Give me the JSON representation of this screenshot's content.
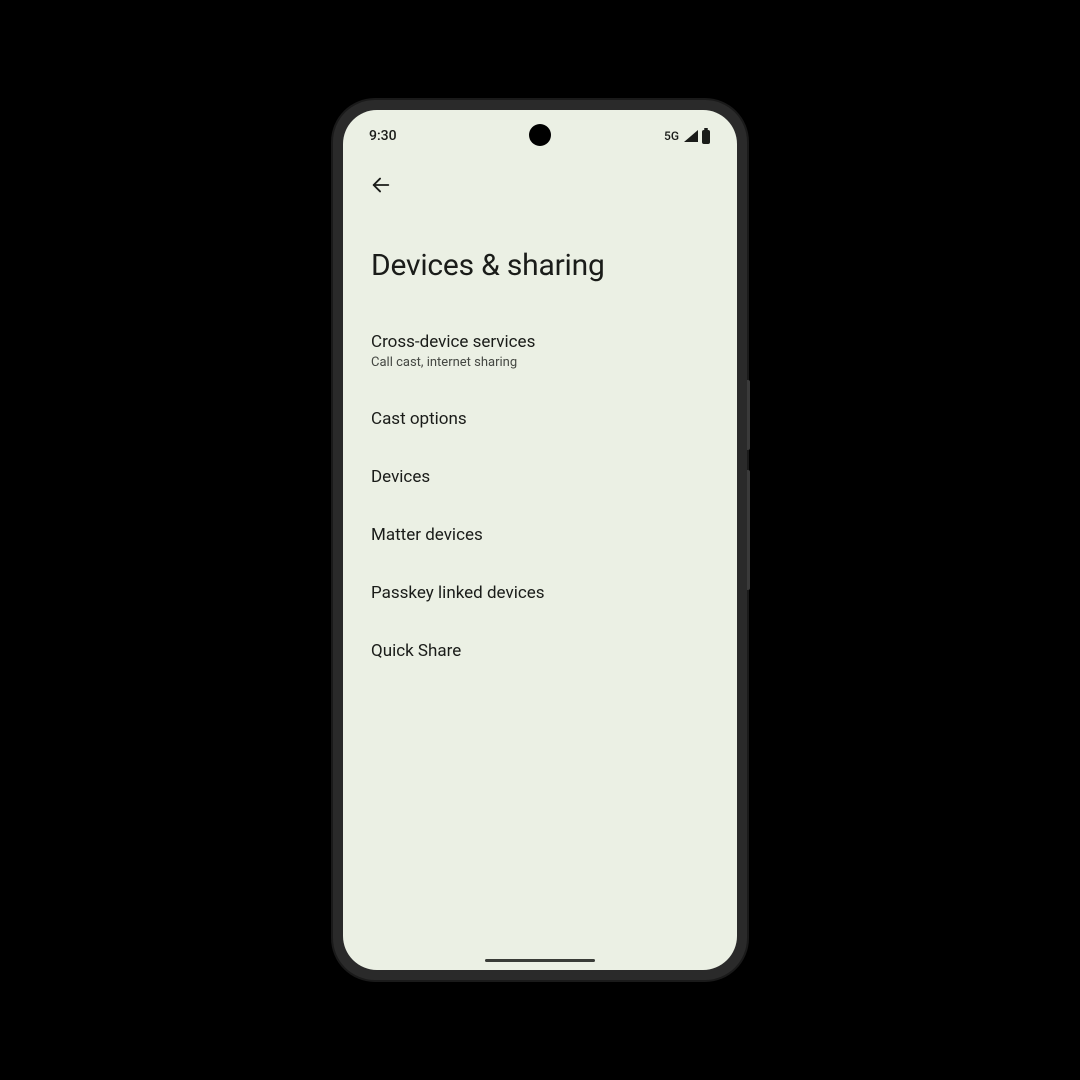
{
  "statusBar": {
    "time": "9:30",
    "network": "5G"
  },
  "page": {
    "title": "Devices & sharing"
  },
  "menu": {
    "items": [
      {
        "title": "Cross-device services",
        "subtitle": "Call cast, internet sharing"
      },
      {
        "title": "Cast options",
        "subtitle": null
      },
      {
        "title": "Devices",
        "subtitle": null
      },
      {
        "title": "Matter devices",
        "subtitle": null
      },
      {
        "title": "Passkey linked devices",
        "subtitle": null
      },
      {
        "title": "Quick Share",
        "subtitle": null
      }
    ]
  }
}
